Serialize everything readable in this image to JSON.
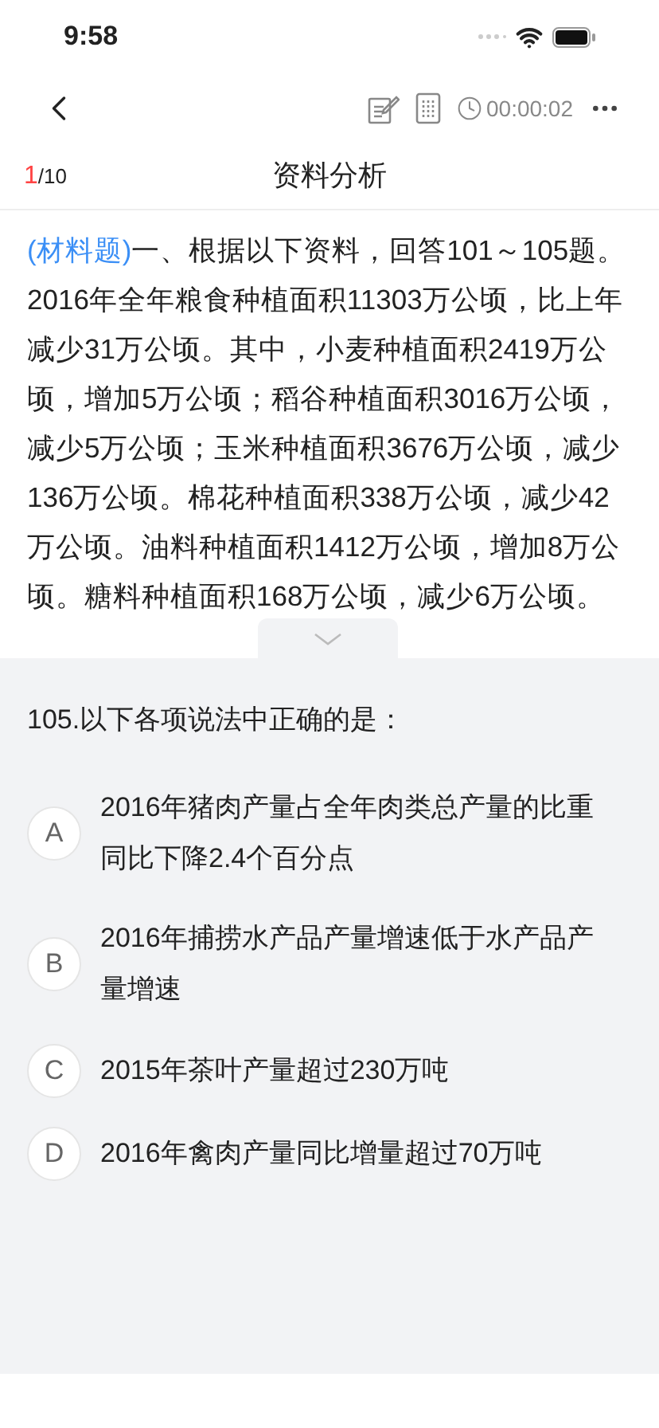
{
  "status_bar": {
    "time": "9:58"
  },
  "toolbar": {
    "timer": "00:00:02"
  },
  "header": {
    "current": "1",
    "total": "/10",
    "title": "资料分析"
  },
  "passage": {
    "type_label": "(材料题)",
    "text": "一、根据以下资料，回答101～105题。2016年全年粮食种植面积11303万公顷，比上年减少31万公顷。其中，小麦种植面积2419万公顷，增加5万公顷；稻谷种植面积3016万公顷，减少5万公顷；玉米种植面积3676万公顷，减少136万公顷。棉花种植面积338万公顷，减少42万公顷。油料种植面积1412万公顷，增加8万公顷。糖料种植面积168万公顷，减少6万公顷。"
  },
  "question": {
    "stem": "105.以下各项说法中正确的是：",
    "options": [
      {
        "letter": "A",
        "text": "2016年猪肉产量占全年肉类总产量的比重同比下降2.4个百分点",
        "selected": false
      },
      {
        "letter": "B",
        "text": "2016年捕捞水产品产量增速低于水产品产量增速",
        "selected": false
      },
      {
        "letter": "C",
        "text": "2015年茶叶产量超过230万吨",
        "selected": false
      },
      {
        "letter": "D",
        "text": "2016年禽肉产量同比增量超过70万吨",
        "selected": false
      }
    ]
  }
}
